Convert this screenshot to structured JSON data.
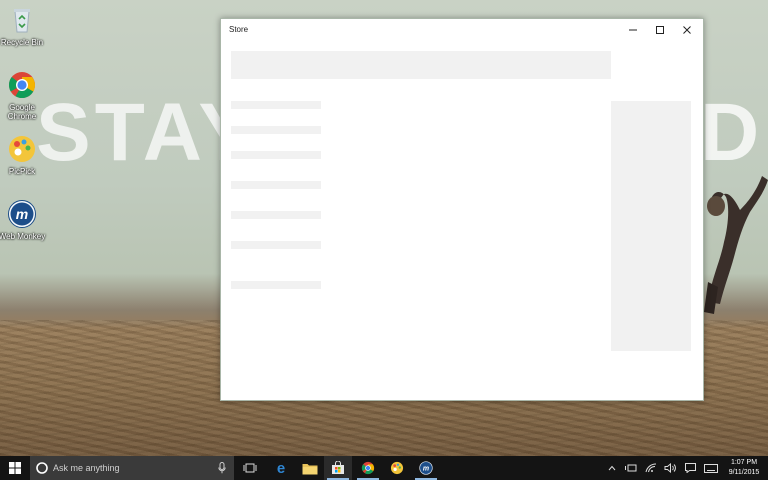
{
  "wallpaper": {
    "text_left": "STAY",
    "text_right": "D"
  },
  "desktop": {
    "icons": [
      {
        "label": "Recycle Bin",
        "icon": "recycle-bin-icon"
      },
      {
        "label": "Google Chrome",
        "icon": "chrome-icon"
      },
      {
        "label": "PicPick",
        "icon": "picpick-icon"
      },
      {
        "label": "Web Monkey",
        "icon": "web-monkey-icon"
      }
    ]
  },
  "window": {
    "title": "Store",
    "minimize_icon": "minimize-icon",
    "maximize_icon": "maximize-icon",
    "close_icon": "close-icon"
  },
  "taskbar": {
    "start_icon": "windows-start-icon",
    "search_placeholder": "Ask me anything",
    "pinned": [
      {
        "icon": "task-view-icon"
      },
      {
        "icon": "edge-icon"
      },
      {
        "icon": "file-explorer-icon"
      },
      {
        "icon": "store-icon",
        "active": true
      },
      {
        "icon": "chrome-icon",
        "active": true
      },
      {
        "icon": "picpick-icon"
      },
      {
        "icon": "web-monkey-icon",
        "active": true
      }
    ],
    "tray_icons": [
      "chevron-up-icon",
      "battery-icon",
      "wifi-icon",
      "volume-icon",
      "action-center-icon",
      "keyboard-icon"
    ],
    "time": "1:07 PM",
    "date": "9/11/2015"
  },
  "colors": {
    "taskbar": "#141414",
    "active_underline": "#8fb8e0",
    "window_bg": "#ffffff"
  }
}
